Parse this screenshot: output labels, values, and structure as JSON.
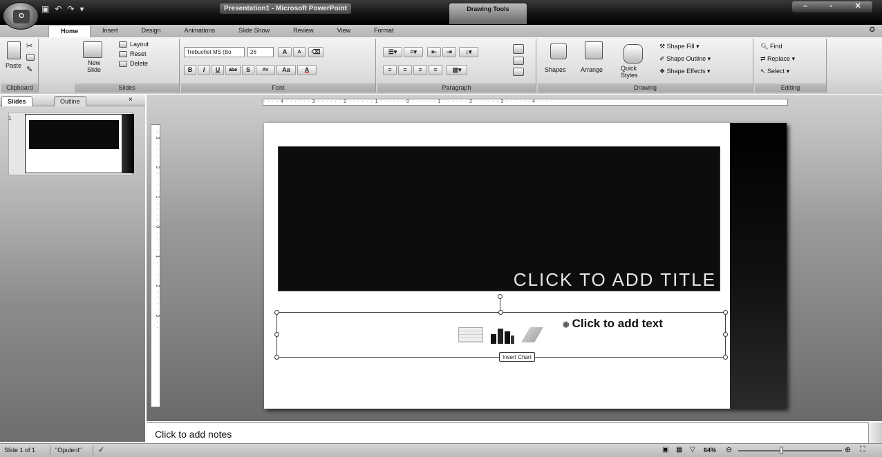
{
  "window": {
    "title": "Presentation1 - Microsoft PowerPoint",
    "contextual_tab_group": "Drawing Tools",
    "controls": [
      "–",
      "▫",
      "✕"
    ]
  },
  "quick_access": [
    "save-icon",
    "undo-icon",
    "redo-icon",
    "customize-icon"
  ],
  "office_button": {
    "label": "O"
  },
  "tabs": [
    "Home",
    "Insert",
    "Design",
    "Animations",
    "Slide Show",
    "Review",
    "View",
    "Format"
  ],
  "active_tab": "Home",
  "ribbon": {
    "clipboard": {
      "label": "Clipboard",
      "paste": "Paste"
    },
    "slides": {
      "label": "Slides",
      "new_slide": "New Slide",
      "layout": "Layout",
      "reset": "Reset",
      "delete": "Delete"
    },
    "font": {
      "label": "Font",
      "family": "Trebuchet MS (Bo",
      "size": "26",
      "grow": "A",
      "shrink": "A",
      "change_case": "Aa",
      "bold": "B",
      "italic": "I",
      "underline": "U",
      "strike": "abe",
      "spacing": "AV"
    },
    "paragraph": {
      "label": "Paragraph"
    },
    "drawing": {
      "label": "Drawing",
      "shapes": "Shapes",
      "arrange": "Arrange",
      "quick_styles": "Quick Styles",
      "shape_fill": "Shape Fill",
      "shape_outline": "Shape Outline",
      "shape_effects": "Shape Effects"
    },
    "editing": {
      "label": "Editing",
      "find": "Find",
      "replace": "Replace",
      "select": "Select"
    }
  },
  "left_pane": {
    "tab_slides": "Slides",
    "tab_outline": "Outline",
    "close": "×",
    "slide_number": "1"
  },
  "ruler": {
    "horizontal": "· · · · 4 · · · · · · 3 · · · · · · 2 · · · · · · 1 · · · · · · 0 · · · · · · 1 · · · · · · 2 · · · · · · 3 · · · · · · 4 · · · ·",
    "vertical": "· · 3 · · · · 2 · · · · 1 · · · · 0 · · · · 1 · · · · 2 · · · · 3 · ·"
  },
  "slide": {
    "title_placeholder": "CLICK TO ADD TITLE",
    "body_placeholder": "Click to add text",
    "tooltip": "Insert Chart"
  },
  "notes": {
    "placeholder": "Click to add notes"
  },
  "status": {
    "slide": "Slide 1 of 1",
    "theme": "\"Opulent\"",
    "zoom": "64%"
  },
  "colors": {
    "title_bar": "#1a1a1a",
    "ribbon": "#e4e4e4",
    "slide_title_bg": "#0d0d0d",
    "slide_side_bar": "#000000"
  }
}
